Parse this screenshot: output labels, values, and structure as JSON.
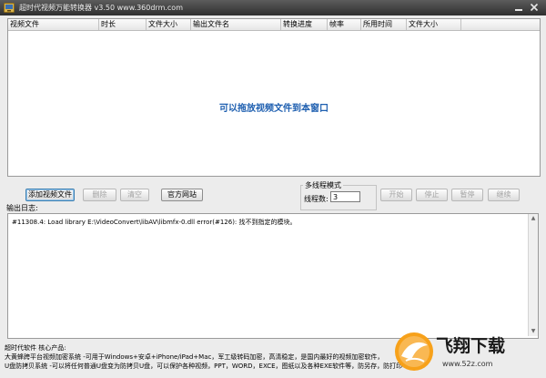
{
  "window": {
    "title": "超时代视频万能转换器 v3.50    www.360drm.com",
    "min_icon": "minimize-icon",
    "close_icon": "close-icon"
  },
  "file_list": {
    "columns": [
      "视频文件",
      "时长",
      "文件大小",
      "输出文件名",
      "转换进度",
      "帧率",
      "所用时间",
      "文件大小"
    ],
    "drop_hint": "可以拖放视频文件到本窗口"
  },
  "toolbar": {
    "add_video": "添加视频文件",
    "delete": "删除",
    "clear": "清空",
    "official_site": "官方网站",
    "start": "开始",
    "stop": "停止",
    "pause": "暂停",
    "resume": "继续"
  },
  "multithread": {
    "group_title": "多线程模式",
    "thread_label": "线程数:",
    "thread_value": "3"
  },
  "log": {
    "label": "输出日志:",
    "lines": [
      "#11308.4: Load library E:\\VideoConvert\\libAV\\libmfx-0.dll error(#126): 找不到指定的模块。"
    ]
  },
  "footer": {
    "lines": [
      "超时代软件 核心产品:",
      "大黄蜂跨平台视频加密系统 -可用于Windows+安卓+iPhone/iPad+Mac，军工级转码加密，高清稳定，是国内最好的视频加密软件，",
      "U盘防拷贝系统 -可以将任何普通U盘变为防拷贝U盘，可以保护各种视频，PPT，WORD，EXCE，图纸以及各种EXE软件等，防另存，防打印"
    ]
  },
  "watermark": {
    "text": "飞翔下载",
    "sub": "www.52z.com"
  }
}
